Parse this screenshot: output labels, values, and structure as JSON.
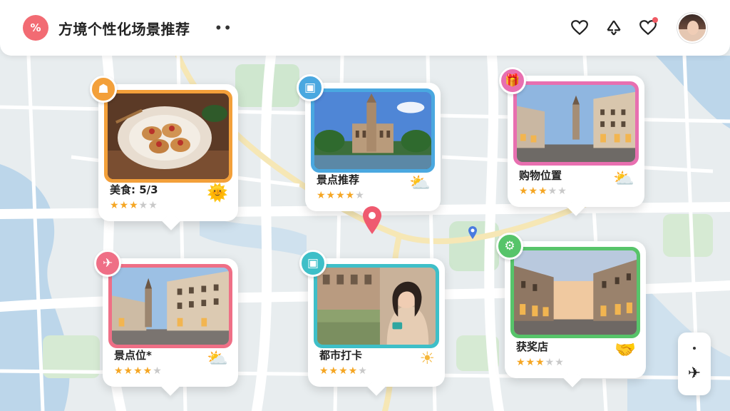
{
  "header": {
    "logo_glyph": "%",
    "title": "方境个性化场景推荐",
    "more": "••",
    "icons": [
      "heart-icon",
      "recycle-icon",
      "heart-notification-icon"
    ],
    "accent": "#f26b73"
  },
  "cards": [
    {
      "id": "food",
      "title": "美食: 5/3",
      "rating": 3,
      "max": 5,
      "badge_icon": "restaurant-icon",
      "side_icon": "sun-bowl-icon",
      "color": "#f3a03a",
      "badge_glyph": "☗",
      "side_glyph": "🌞"
    },
    {
      "id": "castle",
      "title": "景点推荐",
      "rating": 4,
      "max": 5,
      "badge_icon": "photo-icon",
      "side_icon": "sun-cloud-icon",
      "color": "#4aa8e0",
      "badge_glyph": "▣",
      "side_glyph": "⛅"
    },
    {
      "id": "shopping",
      "title": "购物位置",
      "rating": 3,
      "max": 5,
      "badge_icon": "gift-icon",
      "side_icon": "sun-cloud-icon",
      "color": "#e86fb0",
      "badge_glyph": "🎁",
      "side_glyph": "⛅"
    },
    {
      "id": "street",
      "title": "景点位*",
      "rating": 4,
      "max": 5,
      "badge_icon": "airplane-icon",
      "side_icon": "sun-cloud-icon",
      "color": "#ef6f86",
      "badge_glyph": "✈",
      "side_glyph": "⛅"
    },
    {
      "id": "people",
      "title": "都市打卡",
      "rating": 4,
      "max": 5,
      "badge_icon": "image-icon",
      "side_icon": "sun-icon",
      "color": "#3ebfc8",
      "badge_glyph": "▣",
      "side_glyph": "☀"
    },
    {
      "id": "town",
      "title": "获奖店",
      "rating": 3,
      "max": 5,
      "badge_icon": "gear-icon",
      "side_icon": "handshake-icon",
      "color": "#57c46a",
      "badge_glyph": "⚙",
      "side_glyph": "🤝"
    }
  ],
  "map_control": {
    "compass_glyph": "✈"
  }
}
